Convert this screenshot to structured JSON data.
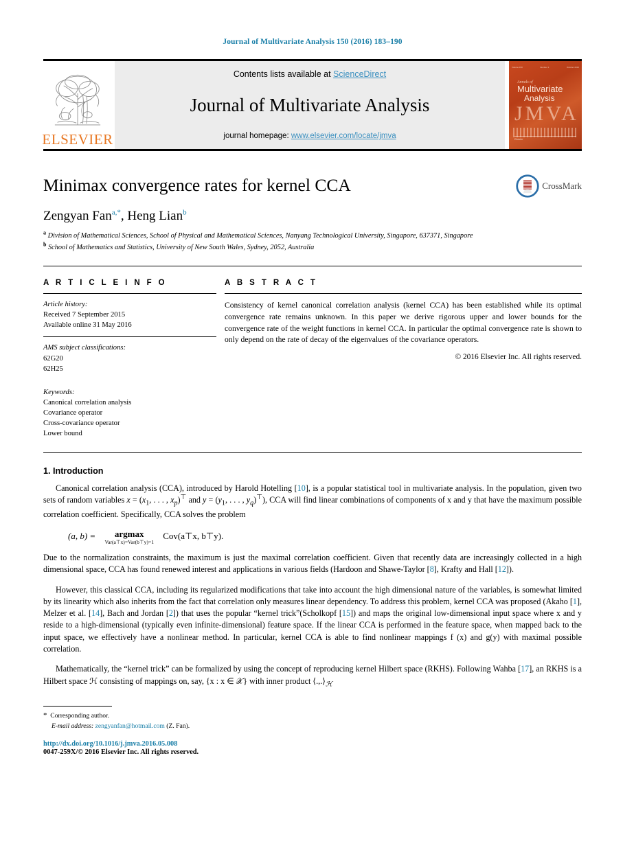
{
  "running_head": "Journal of Multivariate Analysis 150 (2016) 183–190",
  "masthead": {
    "publisher": "ELSEVIER",
    "contents_prefix": "Contents lists available at ",
    "contents_link": "ScienceDirect",
    "journal_name": "Journal of Multivariate Analysis",
    "homepage_prefix": "journal homepage: ",
    "homepage_link": "www.elsevier.com/locate/jmva",
    "cover": {
      "top_left": "Volume 150",
      "top_mid": "Number 1",
      "top_right": "October 2016",
      "annals": "Annals of",
      "title_line1": "Multivariate",
      "title_line2": "Analysis",
      "acronym": "JMVA",
      "footer": "Elsevier"
    }
  },
  "article": {
    "title": "Minimax convergence rates for kernel CCA",
    "crossmark_label": "CrossMark",
    "authors_html": "Zengyan Fan<sup>a,*</sup>, Heng Lian<sup>b</sup>",
    "affiliation_a": "Division of Mathematical Sciences, School of Physical and Mathematical Sciences, Nanyang Technological University, Singapore, 637371, Singapore",
    "affiliation_b": "School of Mathematics and Statistics, University of New South Wales, Sydney, 2052, Australia"
  },
  "info": {
    "heading": "A R T I C L E   I N F O",
    "history_label": "Article history:",
    "history": [
      "Received 7 September 2015",
      "Available online 31 May 2016"
    ],
    "ams_label": "AMS subject classifications:",
    "ams": [
      "62G20",
      "62H25"
    ],
    "keywords_label": "Keywords:",
    "keywords": [
      "Canonical correlation analysis",
      "Covariance operator",
      "Cross-covariance operator",
      "Lower bound"
    ]
  },
  "abstract": {
    "heading": "A B S T R A C T",
    "text": "Consistency of kernel canonical correlation analysis (kernel CCA) has been established while its optimal convergence rate remains unknown. In this paper we derive rigorous upper and lower bounds for the convergence rate of the weight functions in kernel CCA. In particular the optimal convergence rate is shown to only depend on the rate of decay of the eigenvalues of the covariance operators.",
    "copyright": "© 2016 Elsevier Inc. All rights reserved."
  },
  "body": {
    "section_title": "1. Introduction",
    "p1_a": "Canonical correlation analysis (CCA), introduced by Harold Hotelling [",
    "p1_ref1": "10",
    "p1_b": "], is a popular statistical tool in multivariate analysis. In the population, given two sets of random variables x = (x",
    "p1_c": "), CCA will find linear combinations of components of x and y that have the maximum possible correlation coefficient. Specifically, CCA solves the problem",
    "equation": {
      "lhs": "(a, b) =",
      "argmax": "argmax",
      "constraint": "Var(a⊤x)=Var(b⊤y)=1",
      "rhs": "Cov(a⊤x, b⊤y)."
    },
    "p2_a": "Due to the normalization constraints, the maximum is just the maximal correlation coefficient. Given that recently data are increasingly collected in a high dimensional space, CCA has found renewed interest and applications in various fields (Hardoon and Shawe-Taylor [",
    "p2_ref1": "8",
    "p2_b": "], Krafty and Hall [",
    "p2_ref2": "12",
    "p2_c": "]).",
    "p3_a": "However, this classical CCA, including its regularized modifications that take into account the high dimensional nature of the variables, is somewhat limited by its linearity which also inherits from the fact that correlation only measures linear dependency. To address this problem, kernel CCA was proposed (Akaho [",
    "p3_ref1": "1",
    "p3_b": "], Melzer et al. [",
    "p3_ref2": "14",
    "p3_c": "], Bach and Jordan [",
    "p3_ref3": "2",
    "p3_d": "]) that uses the popular “kernel trick”(Scholkopf [",
    "p3_ref4": "15",
    "p3_e": "]) and maps the original low-dimensional input space where x and y reside to a high-dimensional (typically even infinite-dimensional) feature space. If the linear CCA is performed in the feature space, when mapped back to the input space, we effectively have a nonlinear method. In particular, kernel CCA is able to find nonlinear mappings f (x) and g(y) with maximal possible correlation.",
    "p4_a": "Mathematically, the “kernel trick” can be formalized by using the concept of reproducing kernel Hilbert space (RKHS). Following Wahba [",
    "p4_ref1": "17",
    "p4_b": "], an RKHS is a Hilbert space ℋ consisting of mappings on, say, {x : x ∈ 𝒳} with inner product ⟨.,.⟩"
  },
  "footnote": {
    "corresponding": "Corresponding author.",
    "email_label": "E-mail address: ",
    "email": "zengyanfan@hotmail.com",
    "email_suffix": " (Z. Fan).",
    "doi": "http://dx.doi.org/10.1016/j.jmva.2016.05.008",
    "issn": "0047-259X/© 2016 Elsevier Inc. All rights reserved."
  },
  "colors": {
    "link": "#1a7fa8",
    "elsevier_orange": "#e87722",
    "masthead_bg": "#ececec"
  }
}
